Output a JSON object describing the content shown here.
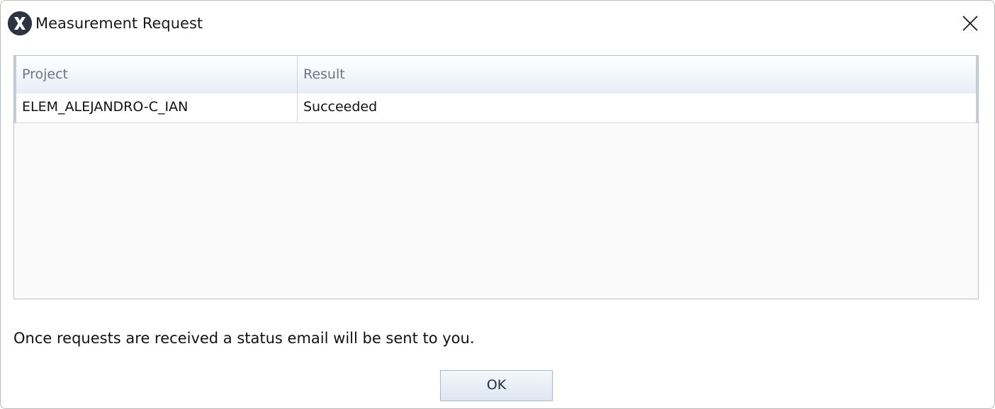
{
  "window": {
    "title": "Measurement Request",
    "icon": "app-x-logo-icon",
    "close_icon": "close-icon"
  },
  "grid": {
    "columns": [
      "Project",
      "Result"
    ],
    "rows": [
      [
        "ELEM_ALEJANDRO-C_IAN",
        "Succeeded"
      ]
    ]
  },
  "message": "Once requests are received a status email will be sent to you.",
  "buttons": {
    "ok_label": "OK"
  },
  "colors": {
    "header_text": "#6a7686",
    "border": "#b8c3cf",
    "button_text": "#1d2f45"
  }
}
